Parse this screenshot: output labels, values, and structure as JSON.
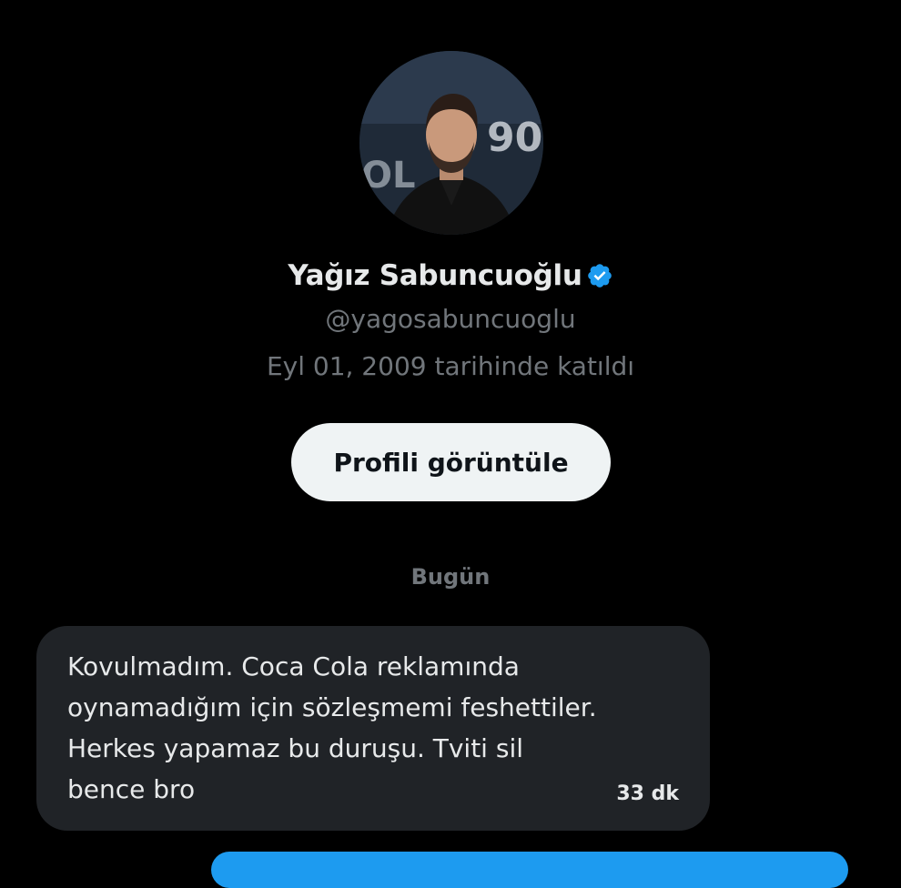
{
  "profile": {
    "display_name": "Yağız Sabuncuoğlu",
    "verified": true,
    "verified_icon": "verified-badge-icon",
    "handle": "@yagosabuncuoglu",
    "joined": "Eyl 01, 2009 tarihinde katıldı",
    "view_profile_label": "Profili görüntüle"
  },
  "conversation": {
    "date_separator": "Bugün",
    "messages": [
      {
        "direction": "incoming",
        "text": "Kovulmadım. Coca Cola reklamında\noynamadığım için sözleşmemi feshettiler.\nHerkes yapamaz bu duruşu. Tviti sil\nbence bro",
        "time": "33 dk"
      }
    ]
  },
  "colors": {
    "background": "#000000",
    "primary_text": "#e7e9ea",
    "secondary_text": "#71767b",
    "button_bg": "#eff3f4",
    "incoming_bubble": "#202327",
    "accent": "#1d9bf0"
  }
}
